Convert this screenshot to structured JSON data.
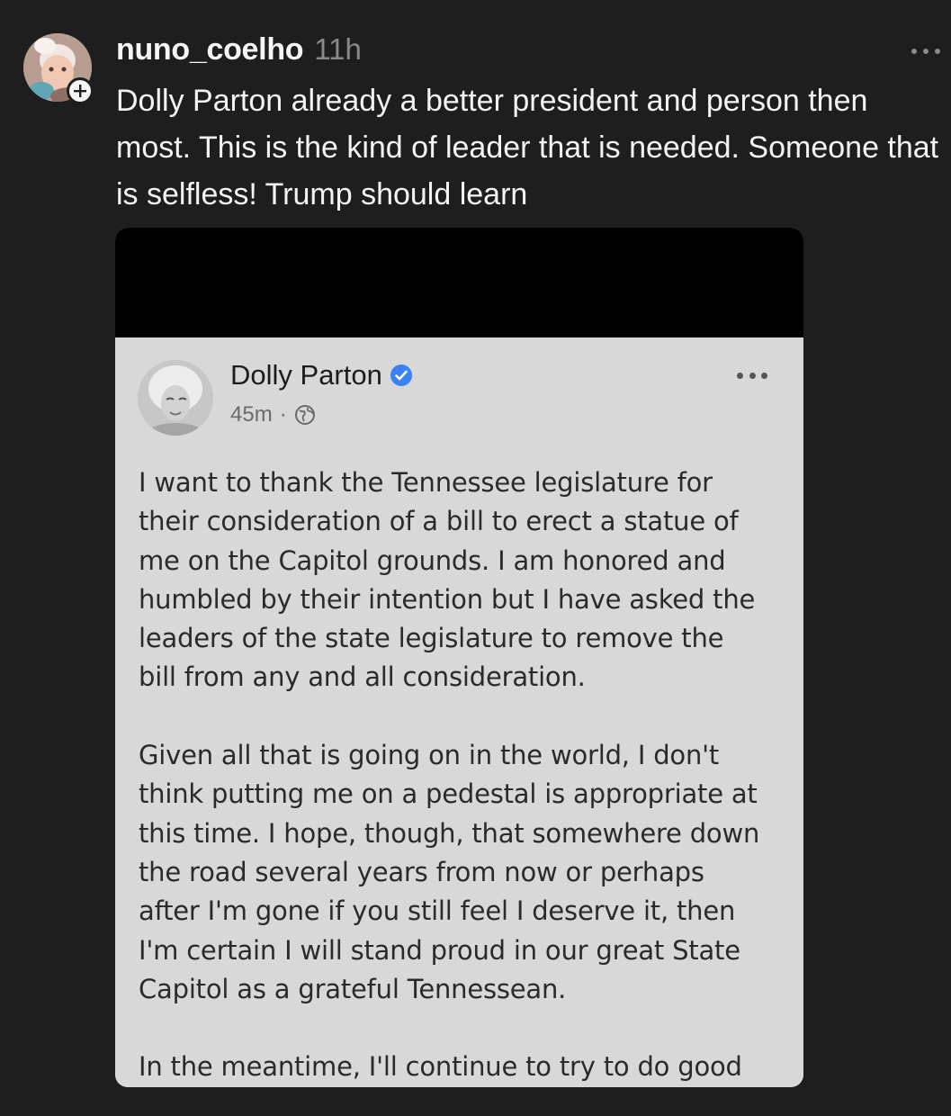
{
  "post": {
    "username": "nuno_coelho",
    "timestamp": "11h",
    "text": "Dolly Parton already a better president and person then most. This is the kind of leader that is needed. Someone that is selfless! Trump should learn",
    "avatar_icon": "user-avatar",
    "follow_icon": "plus-icon",
    "more_icon": "more-horizontal-icon"
  },
  "embedded_post": {
    "author": "Dolly Parton",
    "verified_icon": "verified-badge-icon",
    "time": "45m",
    "separator": "·",
    "audience_icon": "globe-icon",
    "more_icon": "more-horizontal-icon",
    "paragraphs": [
      "I want to thank the Tennessee legislature for\ntheir consideration of a bill to erect a statue of\nme on the Capitol grounds. I am honored and\nhumbled by their intention but I have asked the\nleaders of the state legislature to remove the\nbill from any and all consideration.",
      "Given all that is going on in the world, I don't\nthink putting me on a pedestal is appropriate at\nthis time. I hope, though, that somewhere down\nthe road several years from now or perhaps\nafter I'm gone if you still feel I deserve it, then\nI'm certain I will stand proud in our great State\nCapitol as a grateful Tennessean.",
      "In the meantime, I'll continue to try to do good"
    ]
  },
  "colors": {
    "background": "#1e1e1e",
    "text_primary": "#f3f3f3",
    "text_secondary": "#8a8a8a",
    "card_background": "#d8d8d8",
    "verified_blue": "#3b82f6"
  }
}
